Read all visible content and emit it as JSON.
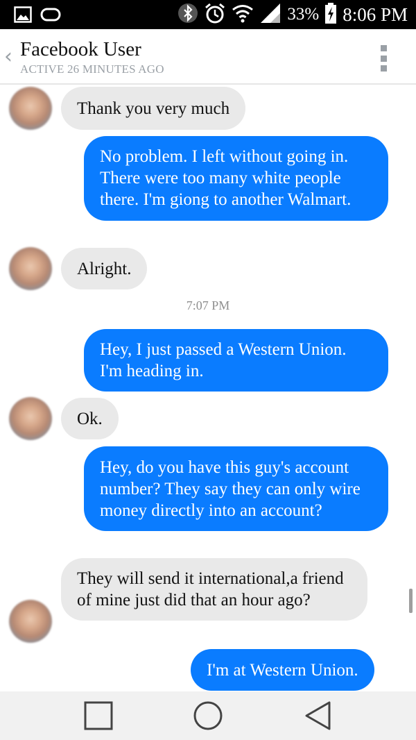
{
  "status_bar": {
    "battery_percent": "33%",
    "time": "8:06 PM",
    "icons": [
      "gallery-icon",
      "voicemail-icon",
      "bluetooth-icon",
      "alarm-icon",
      "wifi-icon",
      "signal-icon",
      "battery-charging-icon"
    ]
  },
  "header": {
    "contact_name": "Facebook User",
    "status": "ACTIVE 26 MINUTES AGO"
  },
  "messages": [
    {
      "direction": "incoming",
      "text": "Thank you very much"
    },
    {
      "direction": "outgoing",
      "text": "No problem. I left without going in. There were too many white people there. I'm giong to another Walmart."
    },
    {
      "direction": "incoming",
      "text": "Alright."
    },
    {
      "direction": "outgoing",
      "text": "Hey, I just passed a Western Union. I'm heading in."
    },
    {
      "direction": "incoming",
      "text": "Ok."
    },
    {
      "direction": "outgoing",
      "text": "Hey, do you have this guy's account number? They say they can only wire money directly into an account?"
    },
    {
      "direction": "incoming",
      "text": "They will send it international,a friend of mine just did that an hour ago?"
    },
    {
      "direction": "outgoing",
      "text": "I'm at Western Union."
    }
  ],
  "timestamp": "7:07 PM",
  "colors": {
    "outgoing_bubble": "#0a7cff",
    "incoming_bubble": "#e9e9e9",
    "status_bar": "#000000",
    "nav_bar": "#f1f1f1"
  },
  "nav_bar": {
    "buttons": [
      "recents-square-icon",
      "home-circle-icon",
      "back-triangle-icon"
    ]
  }
}
